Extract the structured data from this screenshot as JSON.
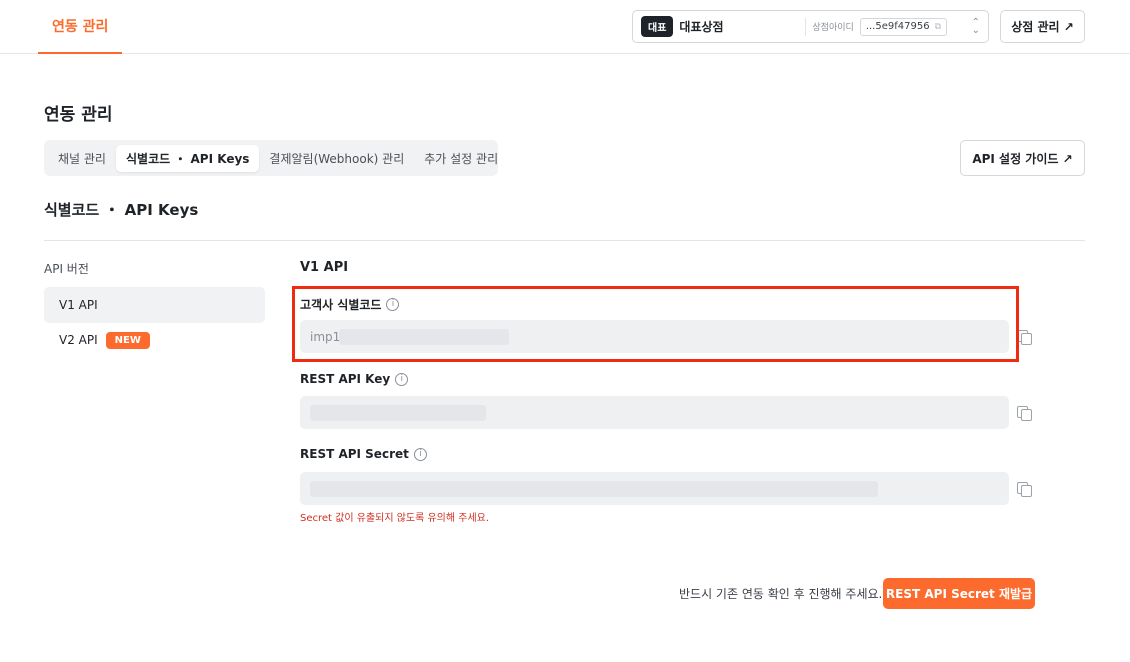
{
  "topbar": {
    "tab": "연동 관리",
    "store": {
      "badge": "대표",
      "name": "대표상점",
      "id_label": "상점아이디",
      "id_value": "...5e9f47956"
    },
    "manage_store": "상점 관리 ↗"
  },
  "page": {
    "title": "연동 관리",
    "tabs": [
      {
        "label": "채널 관리"
      },
      {
        "label": "식별코드 ・ API Keys"
      },
      {
        "label": "결제알림(Webhook) 관리"
      },
      {
        "label": "추가 설정 관리"
      }
    ],
    "guide_button": "API 설정 가이드 ↗",
    "section_title": "식별코드 ・ API Keys"
  },
  "nav": {
    "label": "API 버전",
    "items": [
      {
        "label": "V1 API"
      },
      {
        "label": "V2 API",
        "badge": "NEW"
      }
    ]
  },
  "content": {
    "title": "V1 API",
    "fields": [
      {
        "label": "고객사 식별코드",
        "value": "imp1"
      },
      {
        "label": "REST API Key",
        "value": ""
      },
      {
        "label": "REST API Secret",
        "value": ""
      }
    ],
    "warning": "Secret 값이 유출되지 않도록 유의해 주세요."
  },
  "footer": {
    "note": "반드시 기존 연동 확인 후 진행해 주세요.",
    "reissue_button": "REST API Secret 재발급"
  },
  "colors": {
    "accent": "#fc6b2d",
    "highlight": "#ef2b12",
    "warning": "#d12f22"
  }
}
